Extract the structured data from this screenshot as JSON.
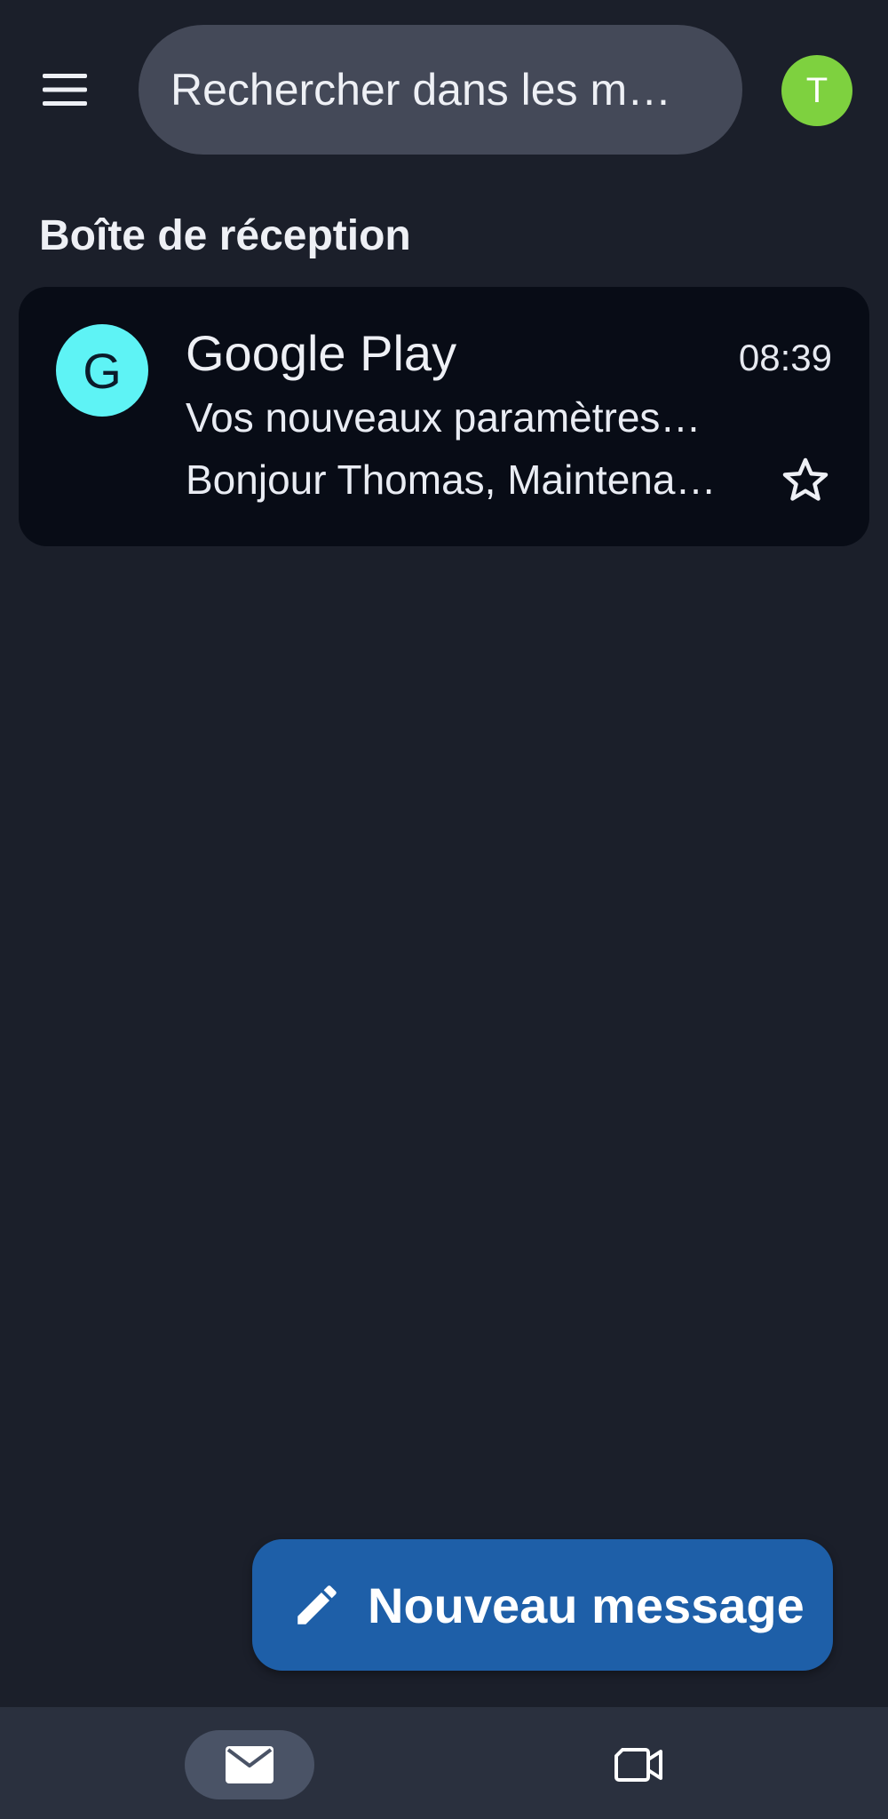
{
  "topbar": {
    "menu_icon": "hamburger-menu-icon",
    "search_placeholder": "Rechercher dans les m…",
    "account_initial": "T",
    "account_color": "#7ed13f"
  },
  "inbox": {
    "title": "Boîte de réception",
    "emails": [
      {
        "avatar_letter": "G",
        "avatar_color": "#5ef3f5",
        "sender": "Google Play",
        "time": "08:39",
        "subject": "Vos nouveaux paramètres…",
        "preview": "Bonjour Thomas, Maintena…",
        "starred": false,
        "star_icon": "star-outline-icon"
      }
    ]
  },
  "compose": {
    "label": "Nouveau message",
    "icon": "pencil-icon",
    "color": "#1e5fa8"
  },
  "bottom_nav": {
    "items": [
      {
        "icon": "mail-icon",
        "selected": true
      },
      {
        "icon": "video-camera-icon",
        "selected": false
      }
    ]
  },
  "colors": {
    "background": "#1b1f2a",
    "card": "#080c16",
    "search": "#444958",
    "nav": "#2a303e"
  }
}
